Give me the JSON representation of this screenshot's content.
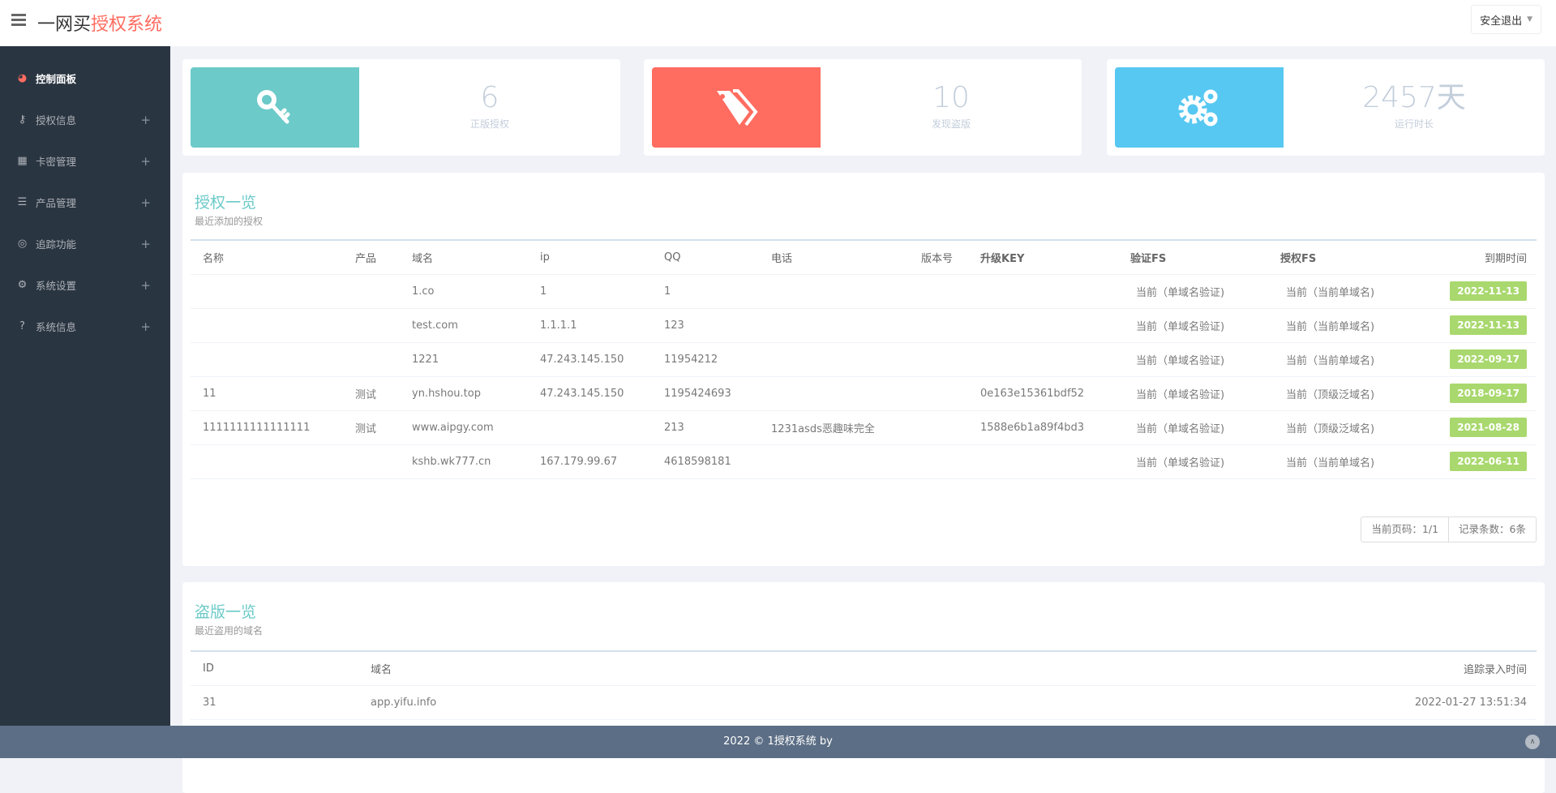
{
  "header": {
    "brand_prefix": "一网买",
    "brand_accent": "授权系统",
    "logout": "安全退出"
  },
  "sidebar": {
    "items": [
      {
        "label": "控制面板",
        "icon": "dashboard-icon",
        "active": true
      },
      {
        "label": "授权信息",
        "icon": "key-icon"
      },
      {
        "label": "卡密管理",
        "icon": "qrcode-icon"
      },
      {
        "label": "产品管理",
        "icon": "list-icon"
      },
      {
        "label": "追踪功能",
        "icon": "target-icon"
      },
      {
        "label": "系统设置",
        "icon": "cogs-icon"
      },
      {
        "label": "系统信息",
        "icon": "question-icon"
      }
    ],
    "expand": "+"
  },
  "stats": [
    {
      "value": "6",
      "label": "正版授权",
      "color": "#6ccac9",
      "icon": "key-icon"
    },
    {
      "value": "10",
      "label": "发现盗版",
      "color": "#ff6c60",
      "icon": "tags-icon"
    },
    {
      "value": "2457天",
      "label": "运行时长",
      "color": "#57c8f2",
      "icon": "cogs-icon"
    }
  ],
  "auth": {
    "title": "授权一览",
    "subtitle": "最近添加的授权",
    "columns": [
      "名称",
      "产品",
      "域名",
      "ip",
      "QQ",
      "电话",
      "版本号",
      "升级KEY",
      "验证FS",
      "授权FS",
      "到期时间"
    ],
    "rows": [
      [
        "",
        "",
        "1.co",
        "1",
        "1",
        "",
        "",
        "",
        "当前（单域名验证)",
        "当前（当前单域名)",
        "2022-11-13"
      ],
      [
        "",
        "",
        "test.com",
        "1.1.1.1",
        "123",
        "",
        "",
        "",
        "当前（单域名验证)",
        "当前（当前单域名)",
        "2022-11-13"
      ],
      [
        "",
        "",
        "1221",
        "47.243.145.150",
        "11954212",
        "",
        "",
        "",
        "当前（单域名验证)",
        "当前（当前单域名)",
        "2022-09-17"
      ],
      [
        "11",
        "测试",
        "yn.hshou.top",
        "47.243.145.150",
        "1195424693",
        "",
        "",
        "0e163e15361bdf52",
        "当前（单域名验证)",
        "当前（顶级泛域名)",
        "2018-09-17"
      ],
      [
        "1111111111111111",
        "测试",
        "www.aipgy.com",
        "",
        "213",
        "1231asds恶趣味完全",
        "",
        "1588e6b1a89f4bd3",
        "当前（单域名验证)",
        "当前（顶级泛域名)",
        "2021-08-28"
      ],
      [
        "",
        "",
        "kshb.wk777.cn",
        "167.179.99.67",
        "4618598181",
        "",
        "",
        "",
        "当前（单域名验证)",
        "当前（当前单域名)",
        "2022-06-11"
      ]
    ],
    "page": "当前页码：1/1",
    "count": "记录条数：6条"
  },
  "piracy": {
    "title": "盗版一览",
    "subtitle": "最近盗用的域名",
    "columns": [
      "ID",
      "域名",
      "追踪录入时间"
    ],
    "rows": [
      [
        "31",
        "app.yifu.info",
        "2022-01-27 13:51:34"
      ]
    ]
  },
  "footer": {
    "text": "2022 © 1授权系统 by"
  }
}
